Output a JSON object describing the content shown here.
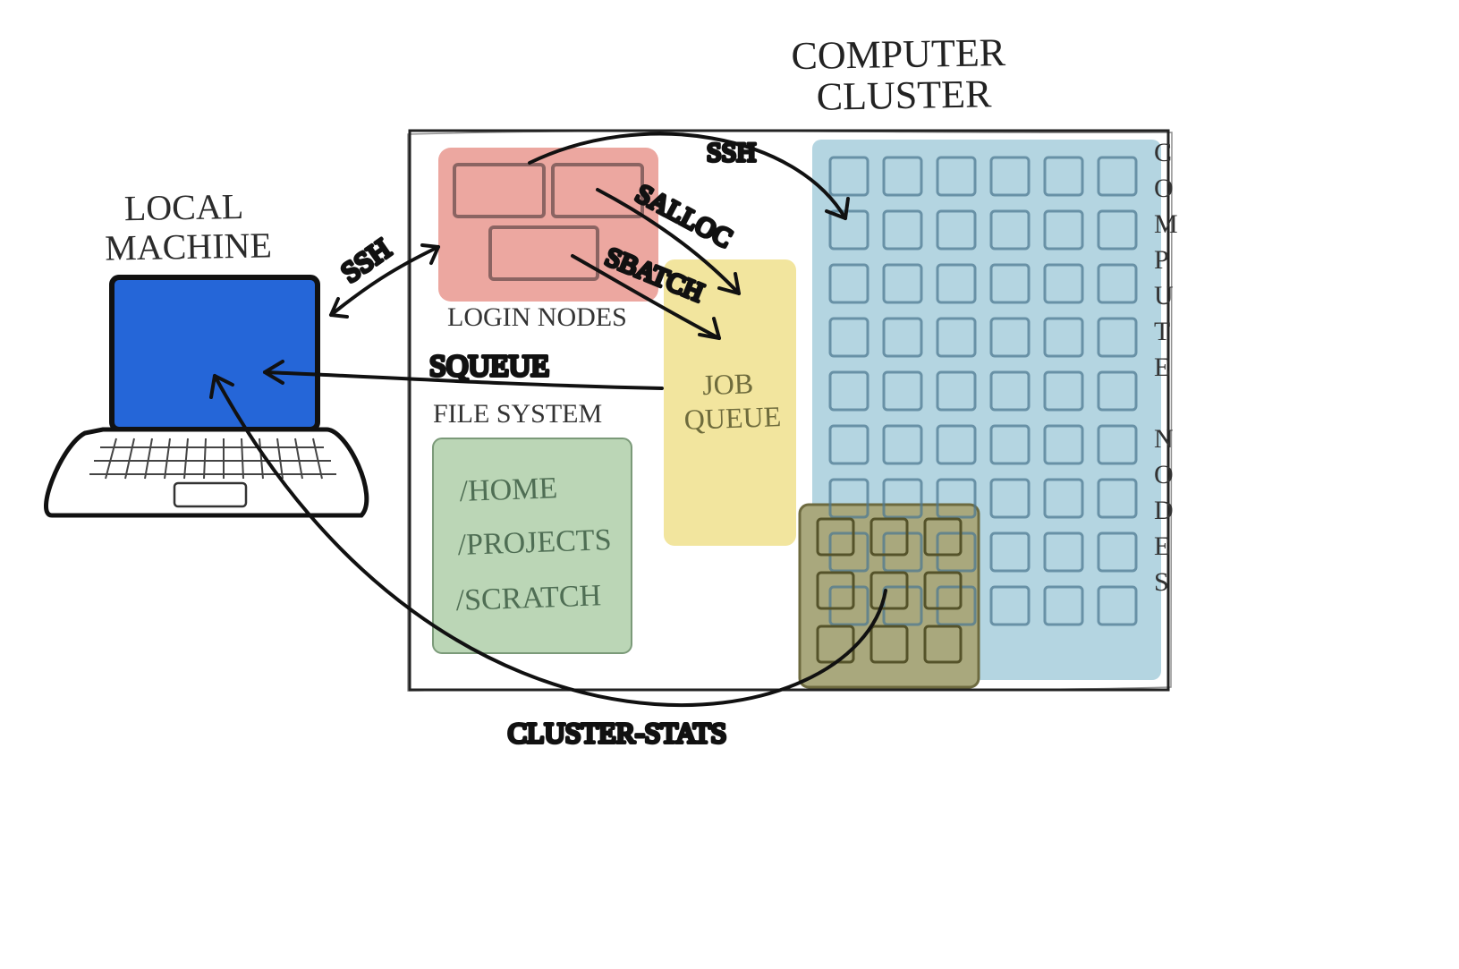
{
  "labels": {
    "local_machine": "LOCAL\nMACHINE",
    "computer_cluster": "COMPUTER\nCLUSTER",
    "login_nodes": "LOGIN NODES",
    "file_system": "FILE SYSTEM",
    "job_queue": "JOB\nQUEUE",
    "compute_nodes": "COMPUTE NODES",
    "ssh": "SSH",
    "salloc": "SALLOC",
    "sbatch": "SBATCH",
    "squeue": "SQUEUE",
    "cluster_stats": "CLUSTER-STATS"
  },
  "filesystem_paths": [
    "/HOME",
    "/PROJECTS",
    "/SCRATCH"
  ],
  "colors": {
    "laptop_screen": "#2566D8",
    "login_nodes": "#ECA7A0",
    "job_queue": "#F2E59E",
    "filesystem": "#BBD6B6",
    "compute_nodes": "#B4D5E1",
    "allocated": "#A9A87D",
    "ink": "#2B2B2B"
  },
  "compute": {
    "cols": 6,
    "rows": 9,
    "alloc_cols": 3,
    "alloc_rows": 3
  }
}
